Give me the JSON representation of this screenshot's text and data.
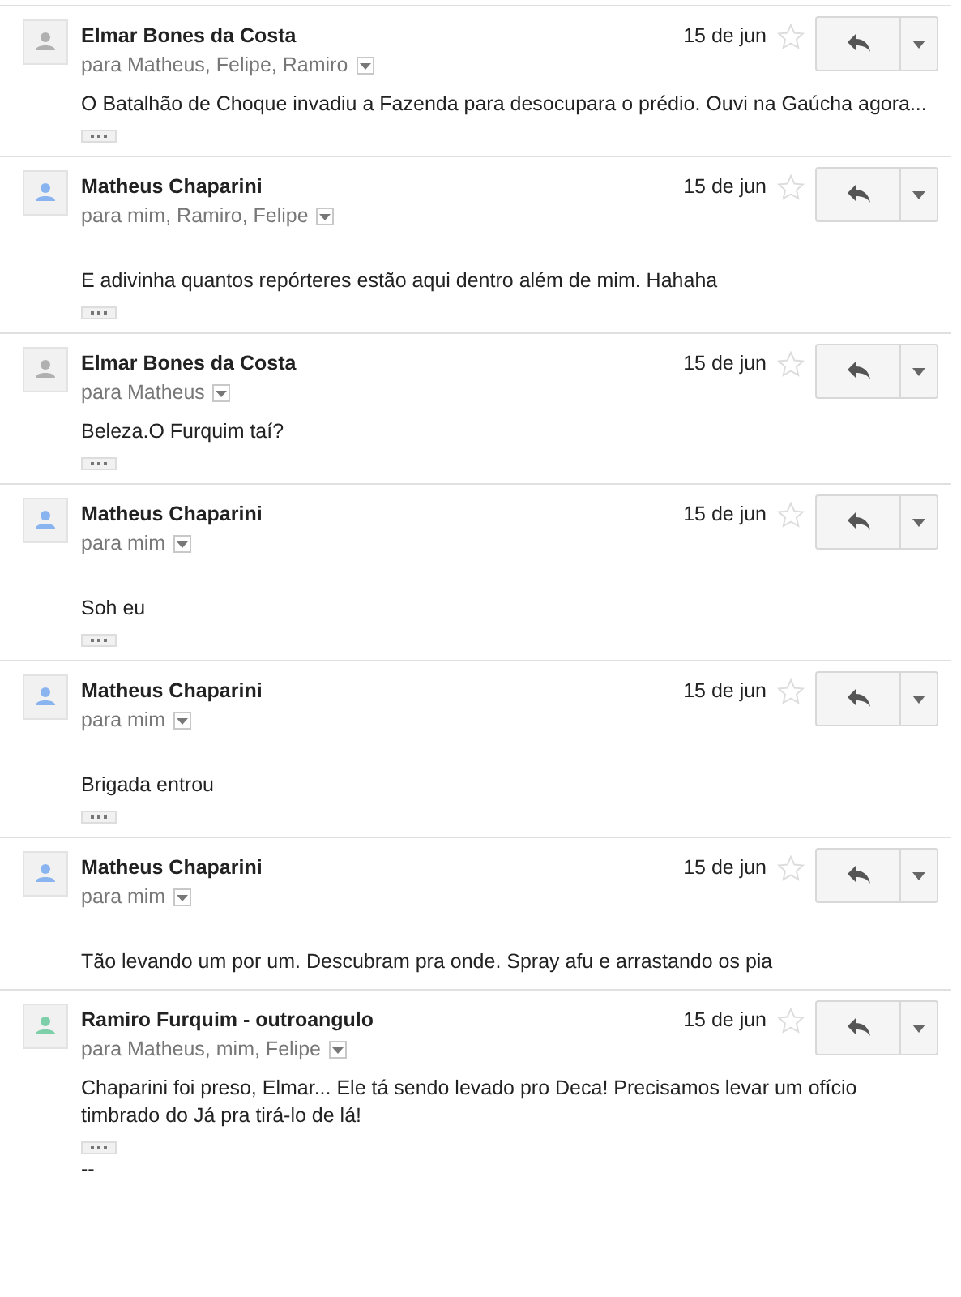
{
  "messages": [
    {
      "sender": "Elmar Bones da Costa",
      "color": "#b0b0b0",
      "recipients": "para Matheus, Felipe, Ramiro",
      "date": "15 de jun",
      "starred": false,
      "spacer": false,
      "body": [
        "O Batalhão de Choque invadiu a Fazenda para desocupara o prédio. Ouvi na Gaúcha agora..."
      ],
      "trimmed": true
    },
    {
      "sender": "Matheus Chaparini",
      "color": "#8ab4f0",
      "recipients": "para mim, Ramiro, Felipe",
      "date": "15 de jun",
      "starred": false,
      "spacer": true,
      "body": [
        "E adivinha quantos repórteres estão aqui dentro além de mim. Hahaha"
      ],
      "trimmed": true
    },
    {
      "sender": "Elmar Bones da Costa",
      "color": "#b0b0b0",
      "recipients": "para Matheus",
      "date": "15 de jun",
      "starred": false,
      "spacer": false,
      "body": [
        "Beleza.O Furquim taí?"
      ],
      "trimmed": true
    },
    {
      "sender": "Matheus Chaparini",
      "color": "#8ab4f0",
      "recipients": "para mim",
      "date": "15 de jun",
      "starred": false,
      "spacer": true,
      "body": [
        "Soh eu"
      ],
      "trimmed": true
    },
    {
      "sender": "Matheus Chaparini",
      "color": "#8ab4f0",
      "recipients": "para mim",
      "date": "15 de jun",
      "starred": false,
      "spacer": true,
      "body": [
        "Brigada entrou"
      ],
      "trimmed": true
    },
    {
      "sender": "Matheus Chaparini",
      "color": "#8ab4f0",
      "recipients": "para mim",
      "date": "15 de jun",
      "starred": false,
      "spacer": true,
      "body": [
        "Tão levando um por um. Descubram pra onde. Spray afu e arrastando os pia"
      ],
      "trimmed": false
    },
    {
      "sender": "Ramiro Furquim - outroangulo",
      "color": "#7ccfa8",
      "recipients": "para Matheus, mim, Felipe",
      "date": "15 de jun",
      "starred": false,
      "spacer": false,
      "body": [
        "Chaparini foi preso, Elmar... Ele tá sendo levado pro Deca! Precisamos levar um ofício timbrado do Já pra tirá-lo de lá!"
      ],
      "trimmed": true,
      "signature": "--"
    }
  ]
}
